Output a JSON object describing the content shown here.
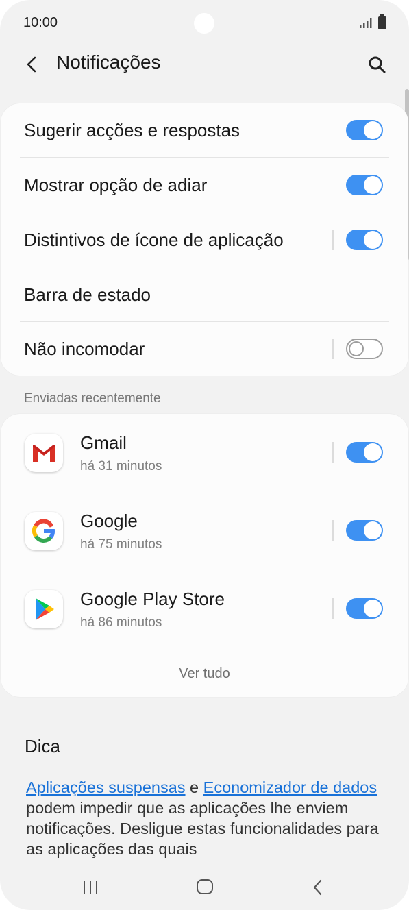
{
  "status_bar": {
    "time": "10:00"
  },
  "header": {
    "title": "Notificações"
  },
  "settings": [
    {
      "label": "Sugerir acções e respostas",
      "toggle": true,
      "separator": false
    },
    {
      "label": "Mostrar opção de adiar",
      "toggle": true,
      "separator": false
    },
    {
      "label": "Distintivos de ícone de aplicação",
      "toggle": true,
      "separator": true
    },
    {
      "label": "Barra de estado",
      "toggle": null,
      "separator": false
    },
    {
      "label": "Não incomodar",
      "toggle": false,
      "separator": true
    }
  ],
  "recent": {
    "header": "Enviadas recentemente",
    "apps": [
      {
        "name": "Gmail",
        "time": "há 31 minutos",
        "icon": "gmail-icon",
        "enabled": true
      },
      {
        "name": "Google",
        "time": "há 75 minutos",
        "icon": "google-icon",
        "enabled": true
      },
      {
        "name": "Google Play Store",
        "time": "há 86 minutos",
        "icon": "play-store-icon",
        "enabled": true
      }
    ],
    "see_all": "Ver tudo"
  },
  "tip": {
    "title": "Dica",
    "link1": "Aplicações suspensas",
    "connector": " e ",
    "link2": "Economizador de dados",
    "text": " podem impedir que as aplicações lhe enviem notificações. Desligue estas funcionalidades para as aplicações das quais"
  },
  "colors": {
    "accent": "#3e91f2",
    "link": "#1871d8",
    "background": "#f2f2f2",
    "card": "#fcfcfc"
  }
}
